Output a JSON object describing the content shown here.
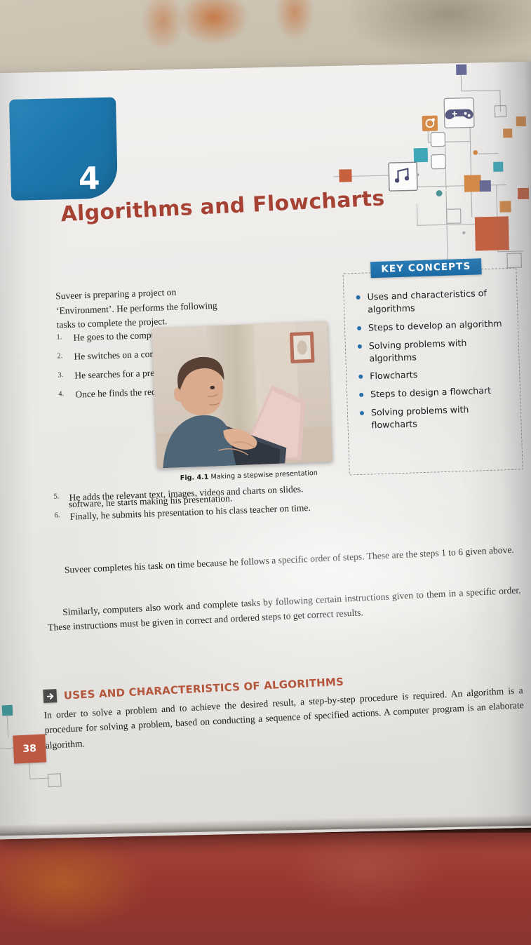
{
  "chapter": {
    "number": "4",
    "title": "Algorithms and Flowcharts"
  },
  "intro": {
    "text": "Suveer is preparing a project on ‘Environment’. He performs the following tasks to complete the project."
  },
  "steps": [
    {
      "num": "1.",
      "text": "He goes to the computer lab."
    },
    {
      "num": "2.",
      "text": "He switches on a computer."
    },
    {
      "num": "3.",
      "text": "He searches for a presentation software."
    },
    {
      "num": "4.",
      "text": "Once he finds the required"
    },
    {
      "num": "5.",
      "text": "He adds the relevant text, images, videos and charts on slides."
    },
    {
      "num": "6.",
      "text": "Finally, he submits his presentation to his class teacher on time."
    }
  ],
  "step4_continuation": "software, he starts making his presentation.",
  "figure": {
    "label": "Fig. 4.1",
    "caption": "Making a stepwise presentation",
    "alt": "A boy sitting at a desk typing on a laptop"
  },
  "key_concepts": {
    "heading": "KEY CONCEPTS",
    "items": [
      "Uses and characteristics of algorithms",
      "Steps to develop an algorithm",
      "Solving problems with algorithms",
      "Flowcharts",
      "Steps to design a flowchart",
      "Solving problems with flowcharts"
    ]
  },
  "paragraphs": {
    "p1": "Suveer completes his task on time because he follows a specific order of steps. These are the steps 1 to 6 given above.",
    "p2": "Similarly, computers also work and complete tasks by following certain instructions given to them in a specific order. These instructions must be given in correct and ordered steps to get correct results."
  },
  "section": {
    "icon": "arrow-right-icon",
    "title": "Uses and Characteristics of Algorithms",
    "body": "In order to solve a problem and to achieve the desired result, a step-by-step procedure is required. An algorithm is a procedure for solving a problem, based on conducting a sequence of specified actions. A computer program is an elaborate algorithm."
  },
  "page_number": "38",
  "decoration": {
    "icons": [
      "gamepad-icon",
      "music-note-icon",
      "gear-icon"
    ],
    "colors": {
      "blue": "#1d78ae",
      "title_red": "#a54233",
      "orange": "#d4823a",
      "teal": "#2fa3b5",
      "purple": "#5b5e8f",
      "brick": "#c4542f",
      "page_badge": "#bd5843"
    }
  }
}
